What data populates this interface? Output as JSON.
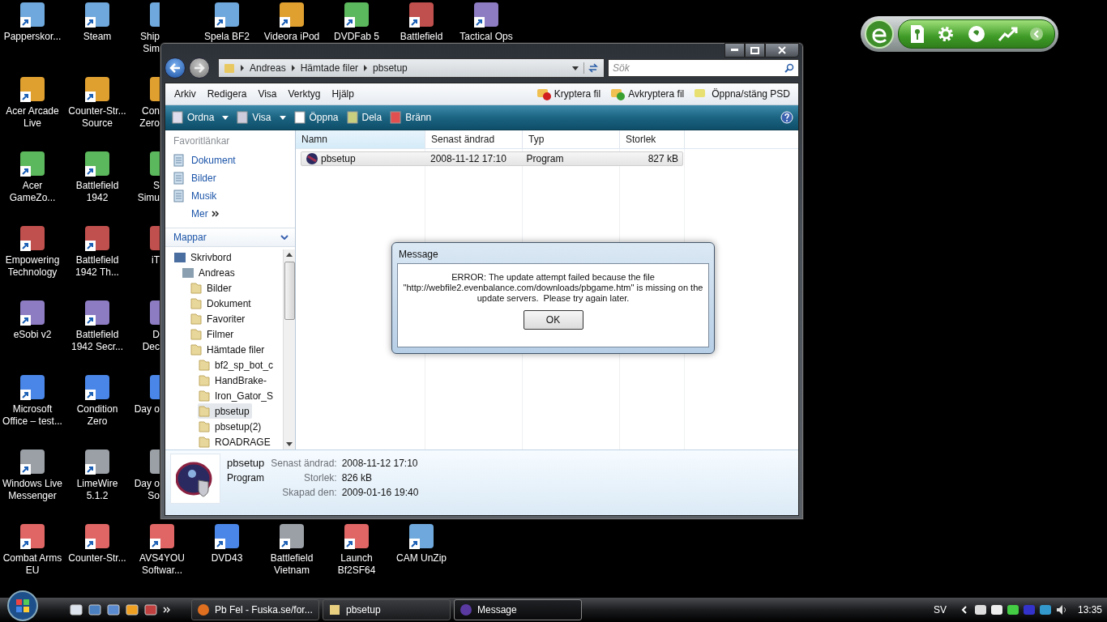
{
  "desktop": {
    "left_columns": [
      [
        {
          "label": [
            "Papperskor..."
          ]
        },
        {
          "label": [
            "Acer Arcade",
            "Live"
          ]
        },
        {
          "label": [
            "Acer",
            "GameZo..."
          ]
        },
        {
          "label": [
            "Empowering",
            "Technology"
          ]
        },
        {
          "label": [
            "eSobi v2"
          ]
        },
        {
          "label": [
            "Microsoft",
            "Office – test..."
          ]
        },
        {
          "label": [
            "Windows Live",
            "Messenger"
          ]
        },
        {
          "label": [
            "Combat Arms",
            "EU"
          ]
        }
      ],
      [
        {
          "label": [
            "Steam"
          ]
        },
        {
          "label": [
            "Counter-Str...",
            "Source"
          ]
        },
        {
          "label": [
            "Battlefield",
            "1942"
          ]
        },
        {
          "label": [
            "Battlefield",
            "1942 Th..."
          ]
        },
        {
          "label": [
            "Battlefield",
            "1942 Secr..."
          ]
        },
        {
          "label": [
            "Condition",
            "Zero"
          ]
        },
        {
          "label": [
            "LimeWire",
            "5.1.2"
          ]
        },
        {
          "label": [
            "Counter-Str..."
          ]
        }
      ],
      [
        {
          "label": [
            "Ship",
            "Sim"
          ]
        },
        {
          "label": [
            "Con",
            "Zero"
          ]
        },
        {
          "label": [
            "S",
            "Simu"
          ]
        },
        {
          "label": [
            "iT"
          ]
        },
        {
          "label": [
            "D",
            "Dec"
          ]
        },
        {
          "label": [
            "Day o"
          ]
        },
        {
          "label": [
            "Day o",
            "So"
          ]
        },
        {
          "label": [
            "AVS4YOU",
            "Softwar..."
          ]
        }
      ]
    ],
    "top_row": [
      {
        "label": [
          "Spela BF2"
        ]
      },
      {
        "label": [
          "Videora iPod"
        ]
      },
      {
        "label": [
          "DVDFab 5"
        ]
      },
      {
        "label": [
          "Battlefield"
        ]
      },
      {
        "label": [
          "Tactical Ops"
        ]
      }
    ],
    "bottom_row": [
      {
        "label": [
          "DVD43"
        ]
      },
      {
        "label": [
          "Battlefield",
          "Vietnam"
        ]
      },
      {
        "label": [
          "Launch",
          "Bf2SF64"
        ]
      },
      {
        "label": [
          "CAM UnZip"
        ]
      }
    ]
  },
  "explorer": {
    "breadcrumb": [
      "Andreas",
      "Hämtade filer",
      "pbsetup"
    ],
    "search": {
      "placeholder": "Sök"
    },
    "menu": [
      "Arkiv",
      "Redigera",
      "Visa",
      "Verktyg",
      "Hjälp"
    ],
    "menu_tools": [
      "Kryptera fil",
      "Avkryptera fil",
      "Öppna/stäng PSD"
    ],
    "commands": [
      {
        "label": "Ordna",
        "dropdown": true
      },
      {
        "label": "Visa",
        "dropdown": true
      },
      {
        "label": "Öppna",
        "dropdown": false
      },
      {
        "label": "Dela",
        "dropdown": false
      },
      {
        "label": "Bränn",
        "dropdown": false
      }
    ],
    "favorites_title": "Favoritlänkar",
    "favorites": [
      "Dokument",
      "Bilder",
      "Musik"
    ],
    "more": "Mer",
    "folders_title": "Mappar",
    "tree": [
      {
        "label": "Skrivbord",
        "selected": false,
        "children": [
          {
            "label": "Andreas",
            "selected": false,
            "children": [
              {
                "label": "Bilder",
                "selected": false
              },
              {
                "label": "Dokument",
                "selected": false
              },
              {
                "label": "Favoriter",
                "selected": false
              },
              {
                "label": "Filmer",
                "selected": false
              },
              {
                "label": "Hämtade filer",
                "selected": false,
                "children": [
                  {
                    "label": "bf2_sp_bot_c",
                    "selected": false
                  },
                  {
                    "label": "HandBrake-",
                    "selected": false
                  },
                  {
                    "label": "Iron_Gator_S",
                    "selected": false
                  },
                  {
                    "label": "pbsetup",
                    "selected": true
                  },
                  {
                    "label": "pbsetup(2)",
                    "selected": false
                  },
                  {
                    "label": "ROADRAGE",
                    "selected": false
                  }
                ]
              }
            ]
          }
        ]
      }
    ],
    "columns": [
      "Namn",
      "Senast ändrad",
      "Typ",
      "Storlek"
    ],
    "files": [
      {
        "name": "pbsetup",
        "modified": "2008-11-12 17:10",
        "type": "Program",
        "size": "827 kB",
        "selected": true
      }
    ],
    "details": {
      "name": "pbsetup",
      "type": "Program",
      "fields": [
        {
          "label": "Senast ändrad:",
          "value": "2008-11-12 17:10"
        },
        {
          "label": "Storlek:",
          "value": "826 kB"
        },
        {
          "label": "Skapad den:",
          "value": "2009-01-16 19:40"
        }
      ]
    }
  },
  "dialog": {
    "title": "Message",
    "text": "ERROR: The update attempt failed because the file \"http://webfile2.evenbalance.com/downloads/pbgame.htm\" is missing on the update servers.  Please try again later.",
    "button": "OK"
  },
  "taskbar": {
    "tasks": [
      {
        "label": "Pb Fel - Fuska.se/for...",
        "selected": false
      },
      {
        "label": "pbsetup",
        "selected": false
      },
      {
        "label": "Message",
        "selected": true
      }
    ],
    "language": "SV",
    "clock": "13:35"
  }
}
